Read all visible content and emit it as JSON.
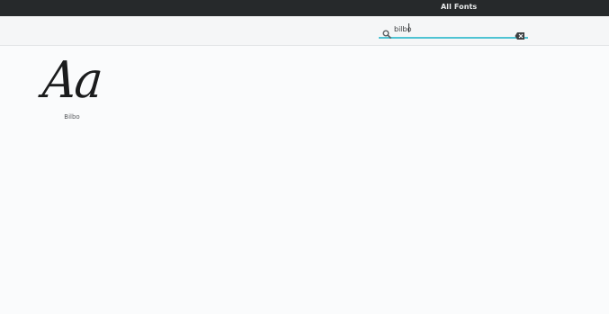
{
  "window": {
    "title": "All Fonts"
  },
  "search": {
    "value": "bilbo",
    "placeholder": ""
  },
  "fonts": [
    {
      "preview_text": "Aa",
      "name": "Bilbo"
    }
  ],
  "colors": {
    "titlebar_bg": "#26292b",
    "accent": "#4fc3d3",
    "content_bg": "#fafbfc"
  },
  "icons": {
    "search": "search-icon",
    "clear": "backspace-clear-icon"
  }
}
